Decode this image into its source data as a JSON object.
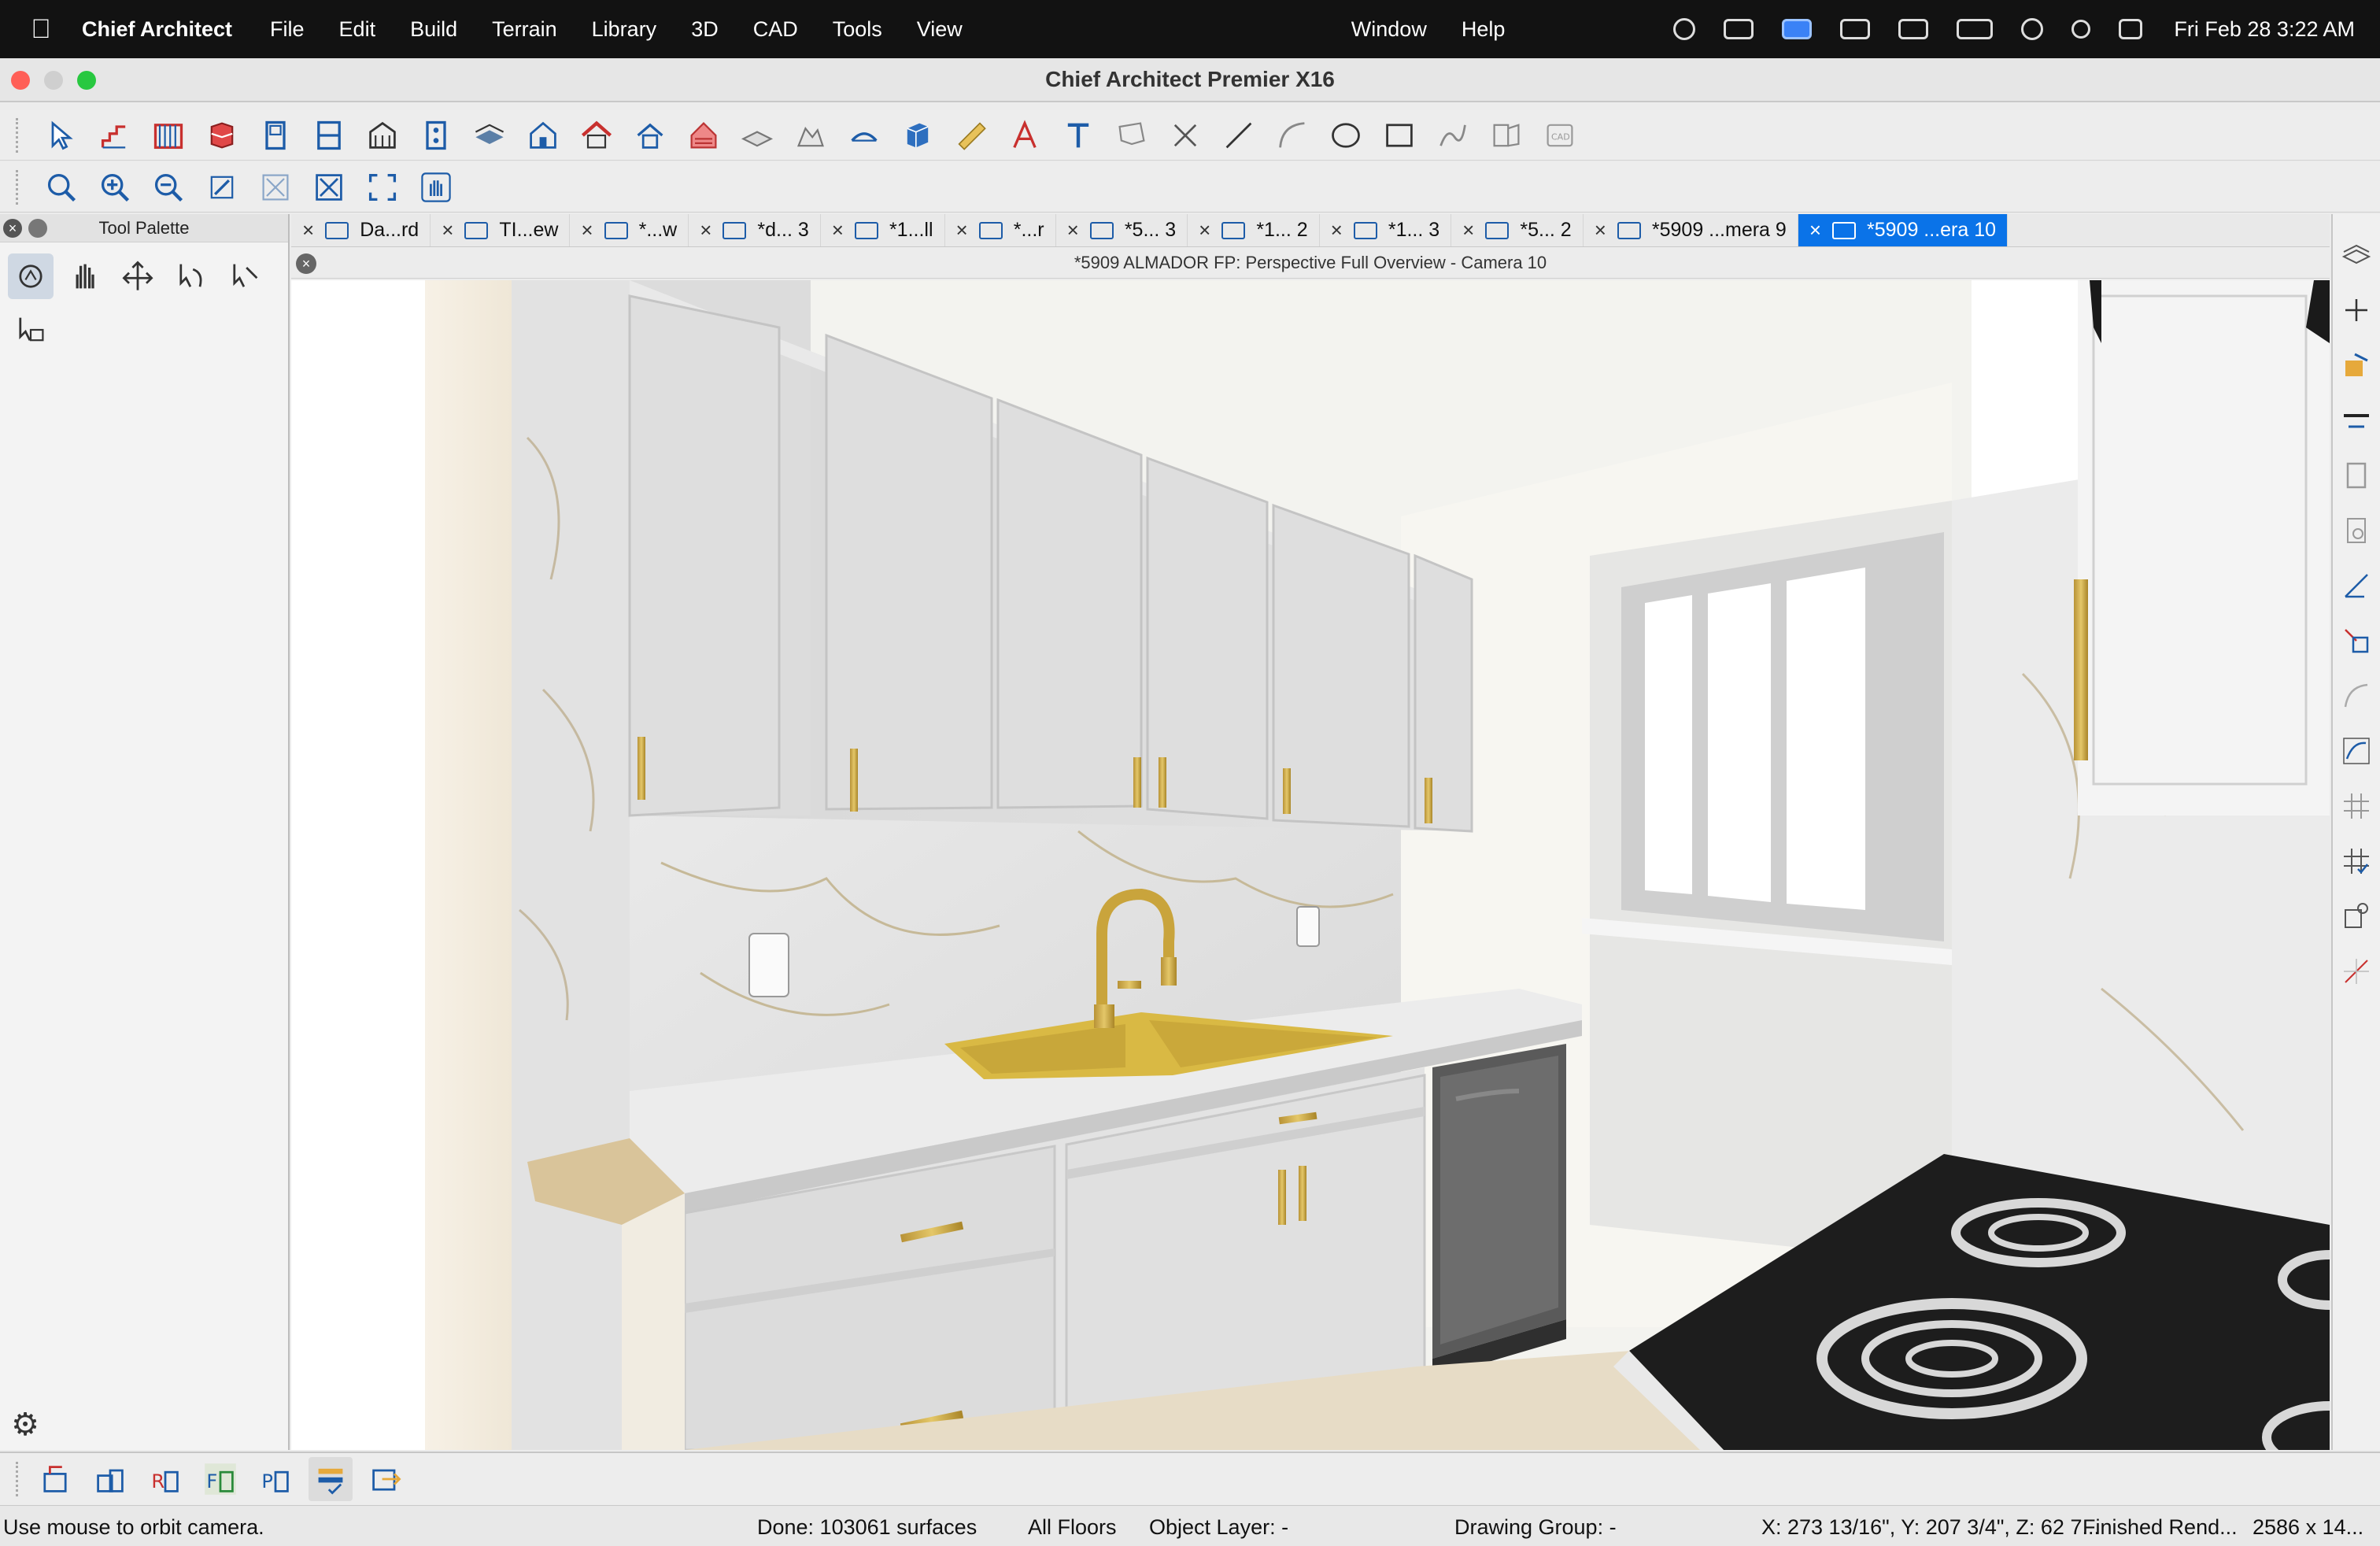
{
  "menubar": {
    "app_name": "Chief Architect",
    "menus": [
      "File",
      "Edit",
      "Build",
      "Terrain",
      "Library",
      "3D",
      "CAD",
      "Tools",
      "View"
    ],
    "right_menus": [
      "Window",
      "Help"
    ],
    "clock": "Fri Feb 28  3:22 AM"
  },
  "window": {
    "title": "Chief Architect Premier X16"
  },
  "palette": {
    "title": "Tool Palette"
  },
  "tabs": [
    {
      "label": "Da...rd"
    },
    {
      "label": "TI...ew"
    },
    {
      "label": "*...w"
    },
    {
      "label": "*d... 3"
    },
    {
      "label": "*1...ll"
    },
    {
      "label": "*...r"
    },
    {
      "label": "*5... 3"
    },
    {
      "label": "*1... 2"
    },
    {
      "label": "*1... 3"
    },
    {
      "label": "*5... 2"
    },
    {
      "label": "*5909 ...mera 9"
    },
    {
      "label": "*5909 ...era 10"
    }
  ],
  "view": {
    "title": "*5909 ALMADOR FP: Perspective Full Overview - Camera 10"
  },
  "status": {
    "hint": "Use mouse to orbit camera.",
    "done": "Done:  103061 surfaces",
    "floors": "All Floors",
    "layer": "Object Layer: -",
    "group": "Drawing Group: -",
    "coords": "X: 273 13/16\", Y: 207 3/4\", Z: 62 7...",
    "render": "Finished Rend...",
    "size": "2586 x 14..."
  },
  "colors": {
    "accent": "#0a73e8",
    "menubar": "#121212",
    "cabinet": "#dcdcdc",
    "hardware": "#c9a43c"
  }
}
